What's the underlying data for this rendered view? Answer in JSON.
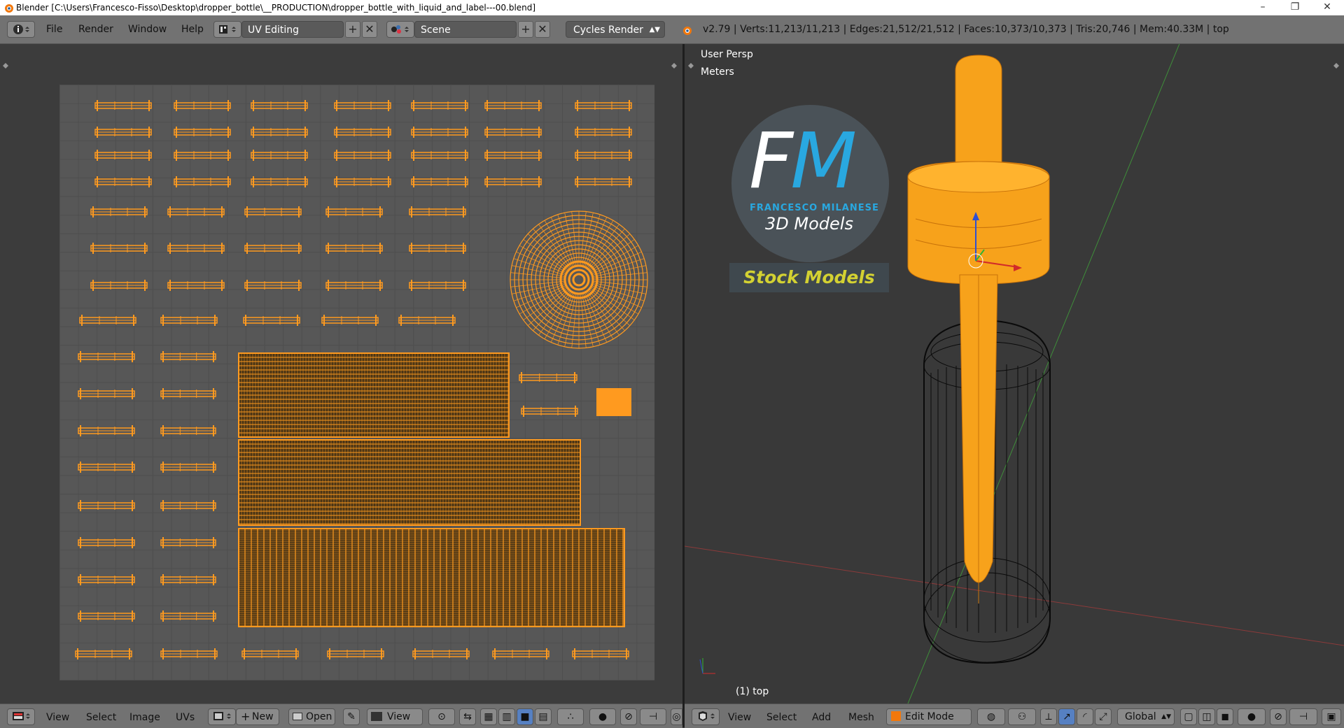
{
  "window": {
    "title": "Blender [C:\\Users\\Francesco-Fisso\\Desktop\\dropper_bottle\\__PRODUCTION\\dropper_bottle_with_liquid_and_label---00.blend]",
    "minimize": "–",
    "maximize": "❐",
    "close": "✕"
  },
  "infobar": {
    "menus": [
      "File",
      "Render",
      "Window",
      "Help"
    ],
    "layout": "UV Editing",
    "scene": "Scene",
    "engine": "Cycles Render",
    "stats": "v2.79 | Verts:11,213/11,213 | Edges:21,512/21,512 | Faces:10,373/10,373 | Tris:20,746 | Mem:40.33M | top"
  },
  "uv_editor": {
    "footer": {
      "menus": [
        "View",
        "Select",
        "Image",
        "UVs"
      ],
      "new_label": "New",
      "open_label": "Open",
      "view_label": "View"
    }
  },
  "viewport": {
    "view_name": "User Persp",
    "units": "Meters",
    "object_label": "(1) top",
    "watermark": {
      "letters_f": "F",
      "letters_m": "M",
      "name": "FRANCESCO MILANESE",
      "sub": "3D Models",
      "stock": "Stock Models"
    },
    "footer": {
      "menus": [
        "View",
        "Select",
        "Add",
        "Mesh"
      ],
      "mode": "Edit Mode",
      "orientation": "Global"
    }
  },
  "colors": {
    "accent": "#ff9a1f",
    "fm_blue": "#29a8e0",
    "stock_yellow": "#d3d132"
  }
}
